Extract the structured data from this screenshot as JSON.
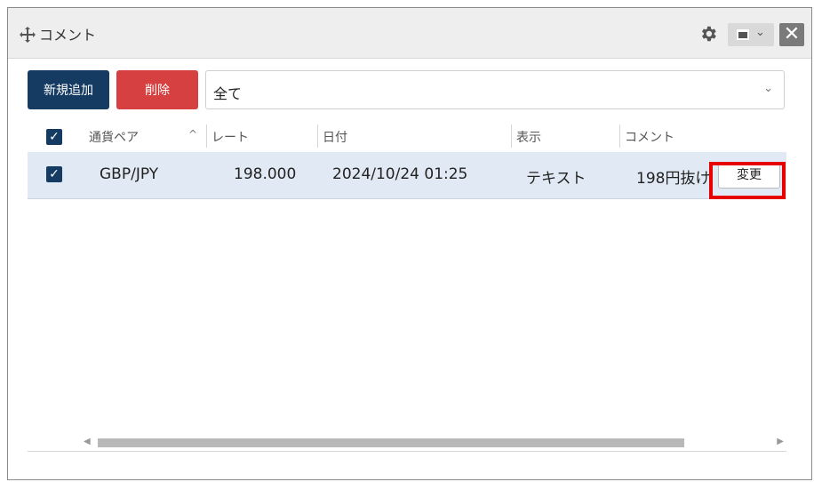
{
  "window": {
    "title": "コメント"
  },
  "toolbar": {
    "new_label": "新規追加",
    "delete_label": "削除",
    "filter_value": "全て"
  },
  "table": {
    "columns": [
      "通貨ペア",
      "レート",
      "日付",
      "表示",
      "コメント"
    ],
    "rows": [
      {
        "checked": true,
        "pair": "GBP/JPY",
        "rate": "198.000",
        "date": "2024/10/24 01:25",
        "display": "テキスト",
        "comment": "198円抜け",
        "edit_label": "変更"
      }
    ]
  },
  "colors": {
    "primary": "#163b63",
    "danger": "#d64040",
    "row_selected": "#e1eaf4",
    "highlight": "#e60000"
  },
  "icons": [
    "move-icon",
    "gear-icon",
    "layout-icon",
    "close-icon",
    "checkbox-icon",
    "sort-asc-icon",
    "chevron-down-icon"
  ]
}
